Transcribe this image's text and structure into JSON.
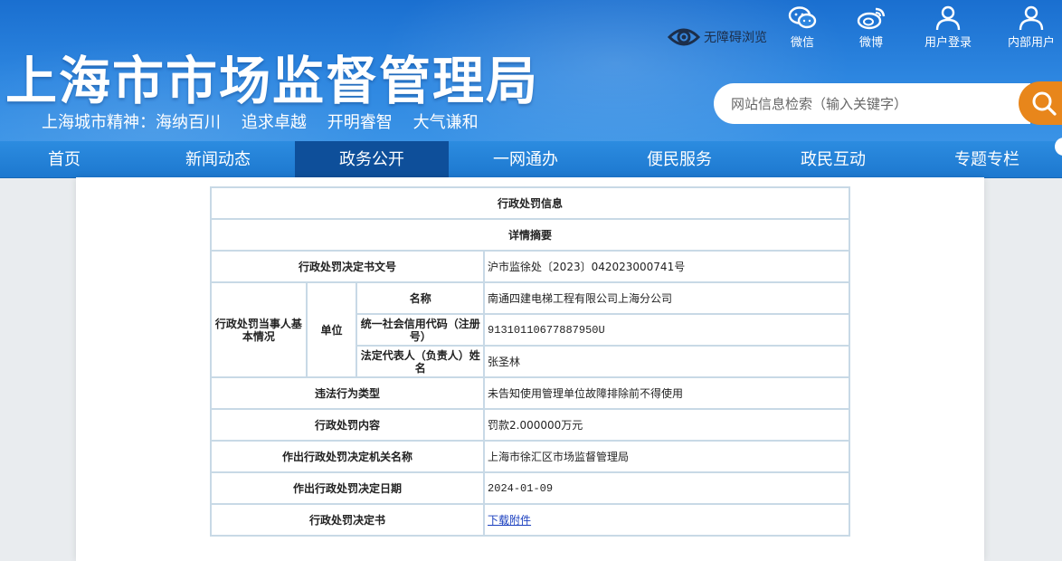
{
  "header": {
    "title": "上海市市场监督管理局",
    "slogan": "上海城市精神：海纳百川    追求卓越    开明睿智    大气谦和",
    "accessibility_label": "无障碍浏览",
    "top_links": [
      {
        "label": "微信",
        "icon": "wechat-icon"
      },
      {
        "label": "微博",
        "icon": "weibo-icon"
      },
      {
        "label": "用户登录",
        "icon": "user-icon"
      },
      {
        "label": "内部用户",
        "icon": "user-icon"
      }
    ],
    "search_placeholder": "网站信息检索（输入关键字）",
    "colors": {
      "header_blue": "#2d86e0",
      "nav_blue": "#2482d8",
      "nav_active": "#0e4f9a",
      "search_button": "#e8861b"
    }
  },
  "nav": {
    "items": [
      "首页",
      "新闻动态",
      "政务公开",
      "一网通办",
      "便民服务",
      "政民互动",
      "专题专栏"
    ],
    "active": "政务公开"
  },
  "detail": {
    "heading": "行政处罚信息",
    "subheading": "详情摘要",
    "rows": {
      "doc_number_label": "行政处罚决定书文号",
      "doc_number": "沪市监徐处〔2023〕042023000741号",
      "party_label": "行政处罚当事人基本情况",
      "unit_label": "单位",
      "name_label": "名称",
      "name": "南通四建电梯工程有限公司上海分公司",
      "credit_code_label": "统一社会信用代码（注册号）",
      "credit_code": "91310110677887950U",
      "legal_rep_label": "法定代表人（负责人）姓名",
      "legal_rep": "张圣林",
      "violation_type_label": "违法行为类型",
      "violation_type": "未告知使用管理单位故障排除前不得使用",
      "penalty_label": "行政处罚内容",
      "penalty": "罚款2.000000万元",
      "authority_label": "作出行政处罚决定机关名称",
      "authority": "上海市徐汇区市场监督管理局",
      "date_label": "作出行政处罚决定日期",
      "date": "2024-01-09",
      "decision_doc_label": "行政处罚决定书",
      "decision_doc_link": "下载附件"
    }
  }
}
